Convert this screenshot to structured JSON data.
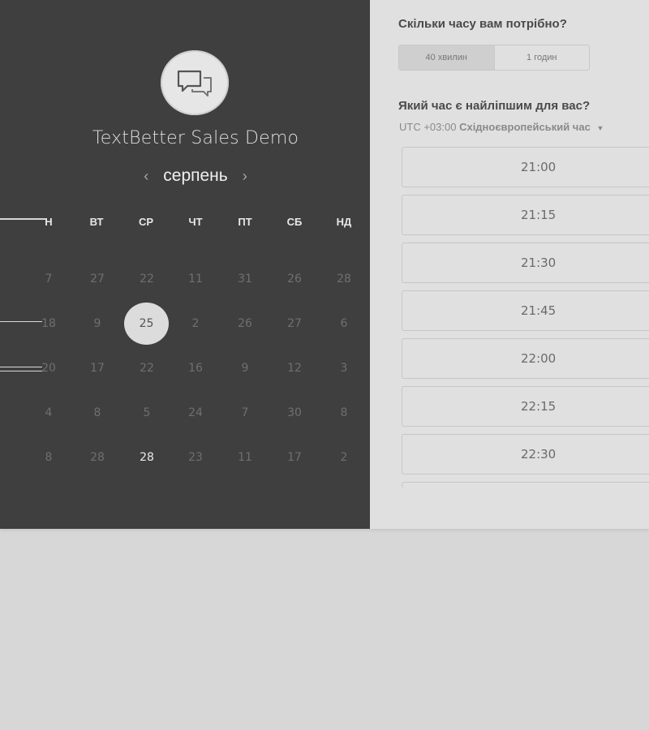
{
  "event": {
    "title": "TextBetter Sales Demo",
    "logo_icon": "chat-bubbles-icon"
  },
  "calendar": {
    "month": "серпень",
    "prev_icon": "chevron-left-icon",
    "next_icon": "chevron-right-icon",
    "weekdays": [
      "ПН",
      "ВТ",
      "СР",
      "ЧТ",
      "ПТ",
      "СБ",
      "НД"
    ],
    "weekday_first_visible": "Н",
    "rows": [
      [
        "7",
        "27",
        "22",
        "11",
        "31",
        "26",
        "28"
      ],
      [
        "18",
        "9",
        "25",
        "2",
        "26",
        "27",
        "6"
      ],
      [
        "20",
        "17",
        "22",
        "16",
        "9",
        "12",
        "3"
      ],
      [
        "4",
        "8",
        "5",
        "24",
        "7",
        "30",
        "8"
      ],
      [
        "8",
        "28",
        "28",
        "23",
        "11",
        "17",
        "2"
      ]
    ],
    "selected_day": "25",
    "highlighted_day": "28"
  },
  "duration": {
    "question": "Скільки часу вам потрібно?",
    "options": [
      "40 хвилин",
      "1 годин"
    ],
    "selected": "40 хвилин"
  },
  "time": {
    "question": "Який час є найліпшим для вас?",
    "tz_offset": "UTC +03:00",
    "tz_name": "Східноєвропейський час",
    "slots": [
      "21:00",
      "21:15",
      "21:30",
      "21:45",
      "22:00",
      "22:15",
      "22:30"
    ]
  },
  "colors": {
    "left_panel": "#3f3f3f",
    "right_panel": "#e0e0e0",
    "page_bg": "#d7d7d7"
  }
}
